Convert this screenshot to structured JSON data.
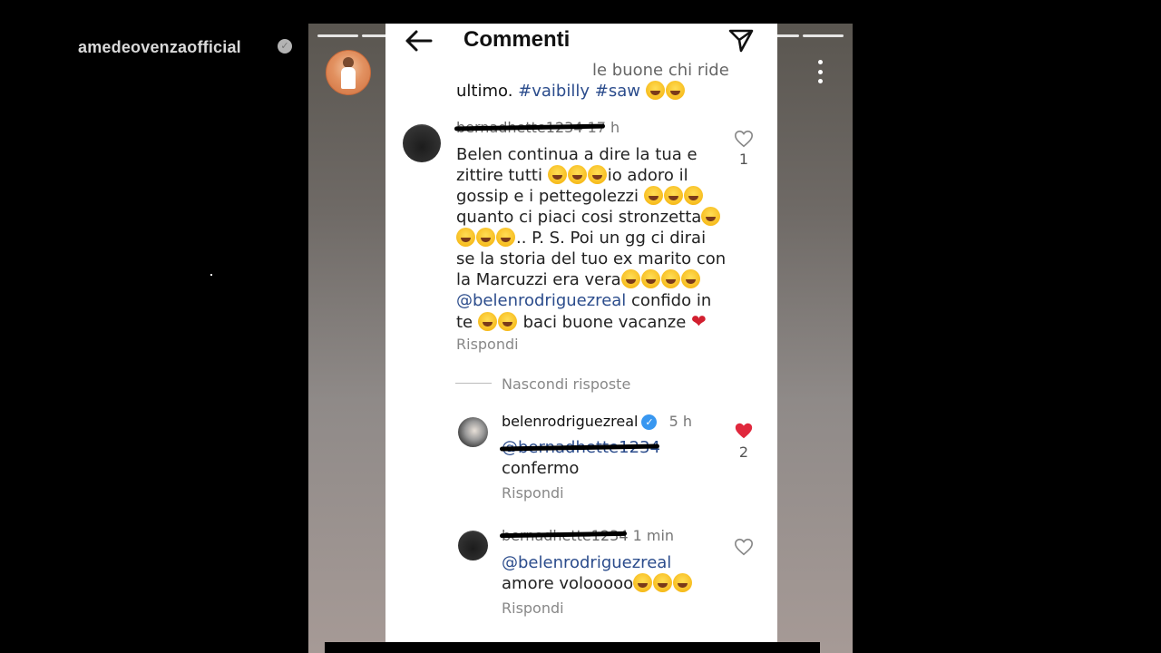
{
  "story": {
    "username": "amedeovenzaofficial",
    "progress_segments": 12
  },
  "header": {
    "title": "Commenti"
  },
  "caption": {
    "line1": "le buone chi ride",
    "line2_text": "ultimo.",
    "hashtags": [
      "#vaibilly",
      "#saw"
    ]
  },
  "comments": [
    {
      "user": "bernadhette1234",
      "time": "17 h",
      "lines": [
        "Belen continua a dire la tua e",
        "zittire tutti",
        "io adoro il",
        "gossip e i pettegolezzi",
        "quanto ci piaci cosi stronzetta",
        ".. P. S. Poi un gg ci dirai",
        "se la storia del tuo ex marito con",
        "la Marcuzzi era vera",
        "@belenrodriguezreal",
        "confido in",
        "te",
        "baci buone vacanze"
      ],
      "likes": "1",
      "reply_label": "Rispondi"
    }
  ],
  "hide_replies_label": "Nascondi risposte",
  "replies": [
    {
      "user": "belenrodriguezreal",
      "time": "5 h",
      "mention": "@bernadhette1234",
      "text": "confermo",
      "likes": "2",
      "liked": true,
      "reply_label": "Rispondi"
    },
    {
      "user": "bernadhette1234",
      "time": "1 min",
      "mention": "@belenrodriguezreal",
      "text": "amore volooooo",
      "reply_label": "Rispondi"
    }
  ],
  "colors": {
    "mention": "#2b4c8c",
    "verified": "#3897f0",
    "liked_heart": "#e0283d"
  }
}
